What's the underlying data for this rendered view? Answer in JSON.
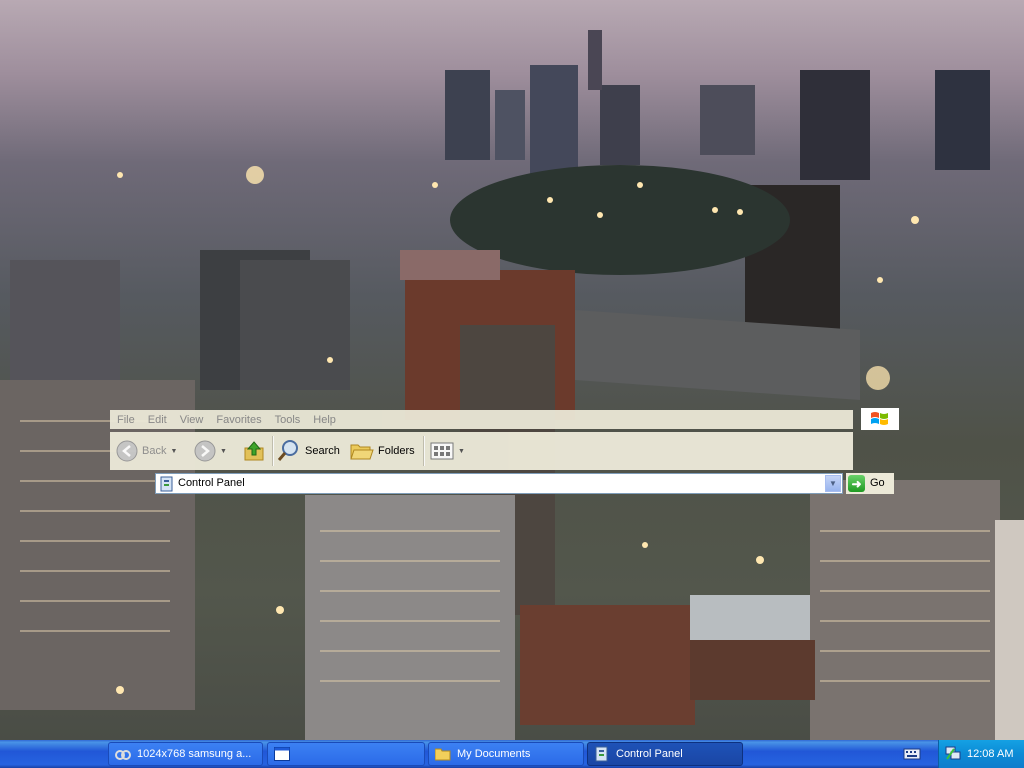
{
  "explorer": {
    "menu": [
      "File",
      "Edit",
      "View",
      "Favorites",
      "Tools",
      "Help"
    ],
    "toolbar": {
      "back_label": "Back",
      "search_label": "Search",
      "folders_label": "Folders"
    },
    "address": {
      "value": "Control Panel",
      "go_label": "Go"
    }
  },
  "taskbar": {
    "tasks": [
      {
        "label": "1024x768 samsung a...",
        "icon": "magnifier-glasses-icon"
      },
      {
        "label": "",
        "icon": "window-icon"
      },
      {
        "label": "My Documents",
        "icon": "folder-icon"
      },
      {
        "label": "Control Panel",
        "icon": "control-panel-icon"
      }
    ],
    "clock": "12:08 AM"
  },
  "colors": {
    "taskbar_blue": "#2457d6",
    "tray_blue": "#0f8bd6",
    "explorer_bg": "#ece9d8"
  }
}
